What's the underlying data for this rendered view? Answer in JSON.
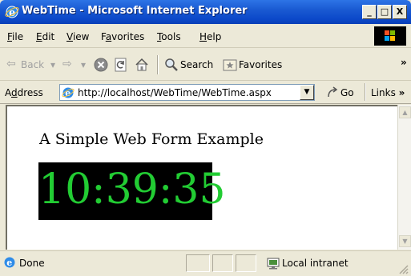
{
  "window": {
    "title": "WebTime - Microsoft Internet Explorer",
    "minimize_label": "_",
    "maximize_label": "□",
    "close_label": "X"
  },
  "menu": {
    "items": [
      {
        "accel": "F",
        "rest": "ile"
      },
      {
        "accel": "E",
        "rest": "dit"
      },
      {
        "accel": "V",
        "rest": "iew"
      },
      {
        "pre": "F",
        "accel": "a",
        "rest": "vorites"
      },
      {
        "accel": "T",
        "rest": "ools"
      },
      {
        "accel": "H",
        "rest": "elp"
      }
    ]
  },
  "toolbar": {
    "back_label": "Back",
    "back_arrow": "⇦",
    "forward_arrow": "⇨",
    "dropdown_glyph": "▾",
    "search_label": "Search",
    "favorites_label": "Favorites",
    "more_glyph": "»"
  },
  "address": {
    "label_pre": "A",
    "label_accel": "d",
    "label_rest": "dress",
    "url": "http://localhost/WebTime/WebTime.aspx",
    "dropdown_glyph": "▼",
    "go_label": "Go",
    "links_label": "Links",
    "links_more": "»"
  },
  "page": {
    "heading": "A Simple Web Form Example",
    "time": "10:39:35",
    "clock_background": "#000000",
    "clock_color": "#22cc33"
  },
  "status": {
    "text": "Done",
    "zone": "Local intranet"
  },
  "colors": {
    "title_bar": "#0b48c9",
    "chrome": "#ece9d8"
  }
}
